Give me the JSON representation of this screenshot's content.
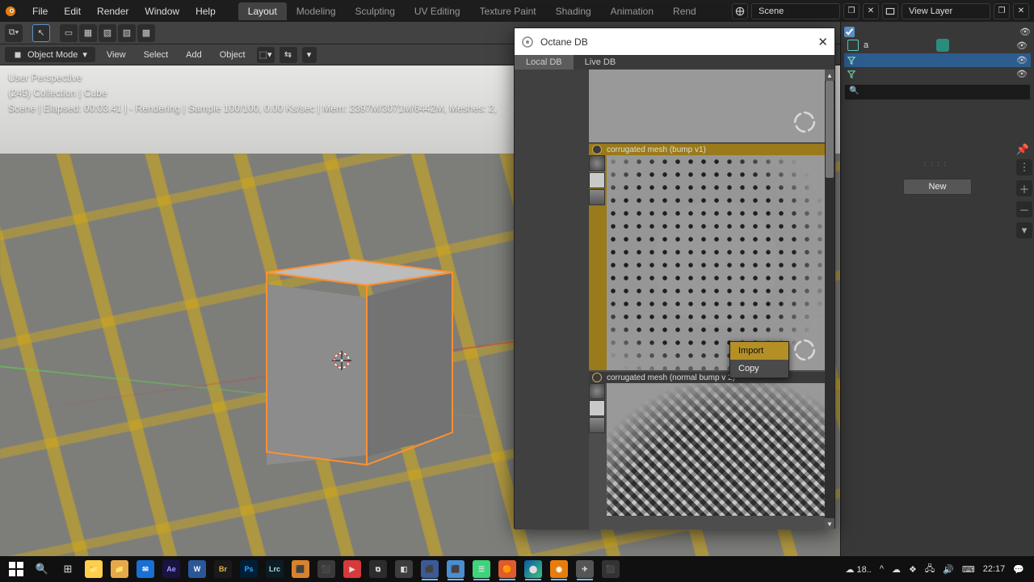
{
  "top_menu": {
    "items": [
      "File",
      "Edit",
      "Render",
      "Window",
      "Help"
    ]
  },
  "workspaces": {
    "tabs": [
      "Layout",
      "Modeling",
      "Sculpting",
      "UV Editing",
      "Texture Paint",
      "Shading",
      "Animation",
      "Rend"
    ],
    "active": 0
  },
  "scene_field": "Scene",
  "layer_field": "View Layer",
  "transform_orientation": "Global",
  "mode_dropdown": "Object Mode",
  "header3_menus": [
    "View",
    "Select",
    "Add",
    "Object"
  ],
  "viewport_overlay": {
    "line1": "User Perspective",
    "line2": "(245) Collection | Cube",
    "line3": "Scene | Elapsed: 00:03.41 |  - Rendering | Sample 100/100, 0.00 Ks/sec | Mem: 2397M/3071M/6442M, Meshes: 2,"
  },
  "dialog": {
    "title": "Octane DB",
    "tabs": [
      "Local DB",
      "Live DB"
    ],
    "active_tab": 0,
    "materials": [
      {
        "name": "",
        "selected": false
      },
      {
        "name": "corrugated mesh (bump v1)",
        "selected": true
      },
      {
        "name": "corrugated mesh (normal bump v 2)",
        "selected": false
      }
    ],
    "context_menu": {
      "items": [
        "Import",
        "Copy"
      ],
      "highlighted": 0
    }
  },
  "outliner": {
    "search_placeholder": "",
    "item_label": "a"
  },
  "properties": {
    "new_button": "New"
  },
  "taskbar": {
    "weather": "18..",
    "time": "22:17"
  }
}
